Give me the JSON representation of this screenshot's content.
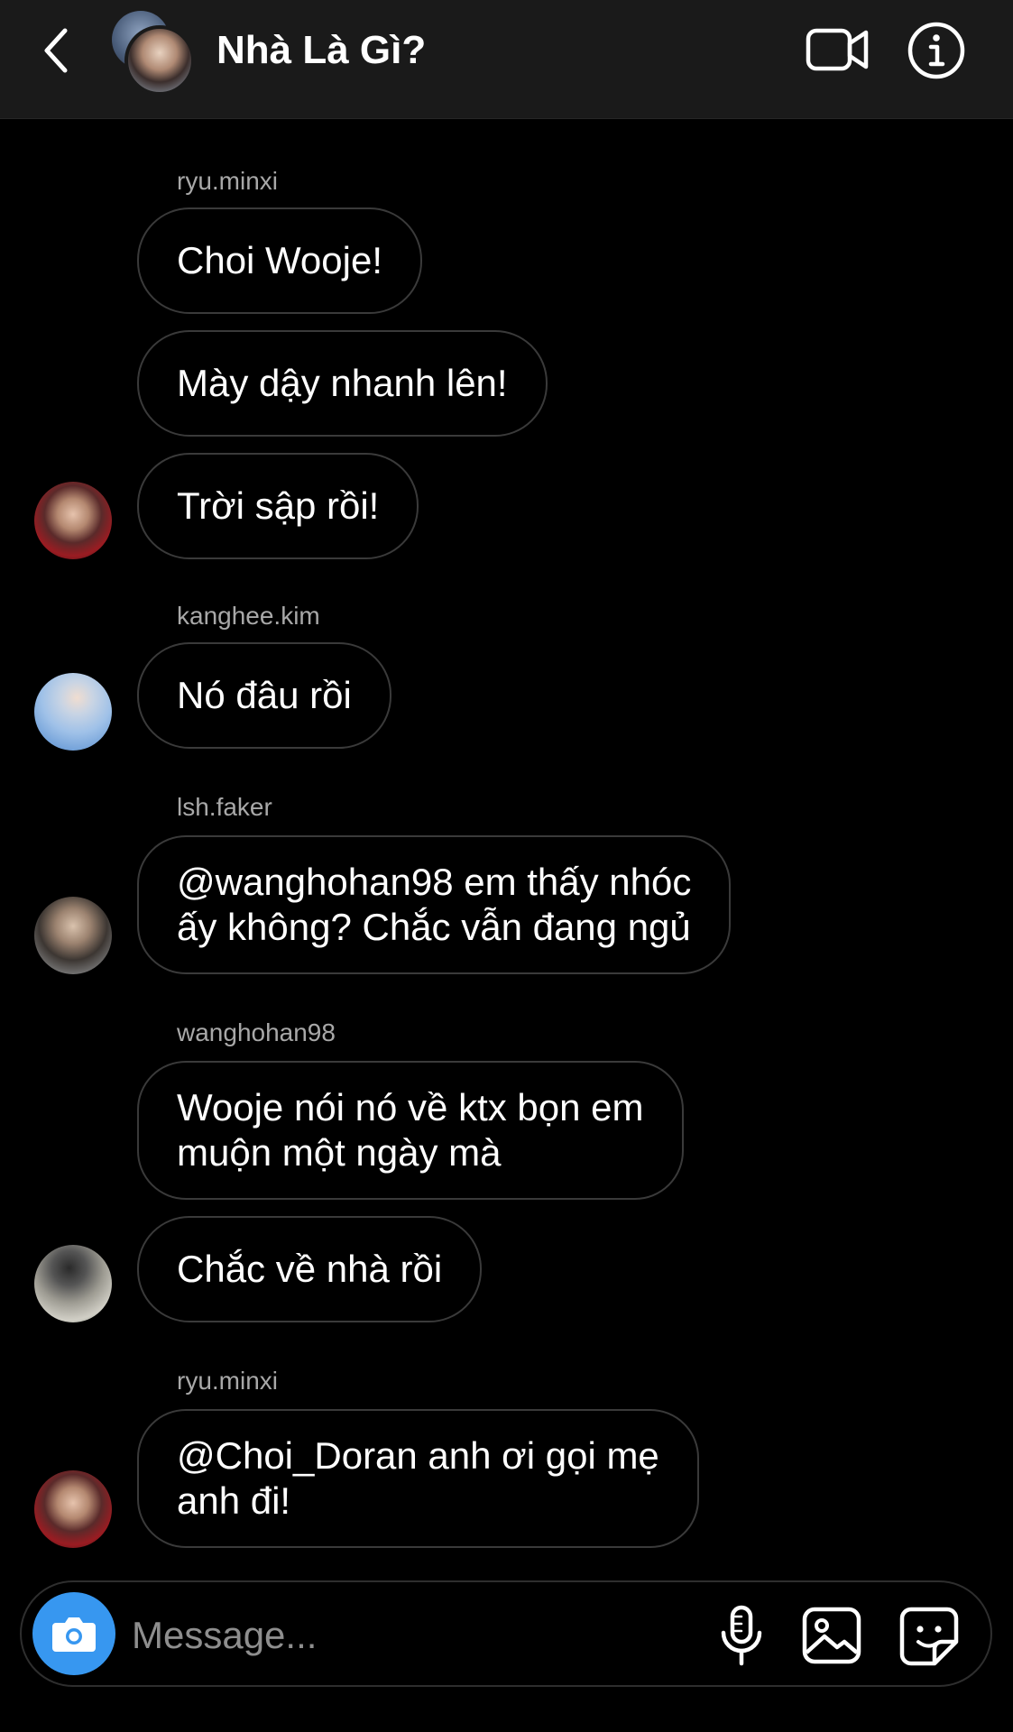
{
  "header": {
    "title": "Nhà Là Gì?",
    "back_icon": "chevron-left-icon",
    "video_icon": "video-camera-icon",
    "info_icon": "info-icon"
  },
  "messages": [
    {
      "sender": "ryu.minxi",
      "bubbles": [
        "Choi Wooje!",
        "Mày dậy nhanh lên!",
        "Trời sập rồi!"
      ]
    },
    {
      "sender": "kanghee.kim",
      "bubbles": [
        "Nó đâu rồi"
      ]
    },
    {
      "sender": "lsh.faker",
      "bubbles": [
        [
          "@wanghohan98 em thấy nhóc",
          "ấy không? Chắc vẫn đang ngủ"
        ]
      ]
    },
    {
      "sender": "wanghohan98",
      "bubbles": [
        [
          "Wooje nói nó về ktx bọn em",
          "muộn một ngày mà"
        ],
        "Chắc về nhà rồi"
      ]
    },
    {
      "sender": "ryu.minxi",
      "bubbles": [
        [
          "@Choi_Doran anh ơi gọi mẹ",
          "anh đi!"
        ]
      ]
    }
  ],
  "composer": {
    "placeholder": "Message...",
    "icons": [
      "camera-icon",
      "microphone-icon",
      "gallery-icon",
      "sticker-icon"
    ]
  },
  "colors": {
    "background": "#000000",
    "header_bg": "#1a1a1a",
    "bubble_border": "#3a3a3a",
    "sender_text": "#a8a8a8",
    "camera_accent": "#3797f0",
    "placeholder": "#8e8e8e"
  }
}
